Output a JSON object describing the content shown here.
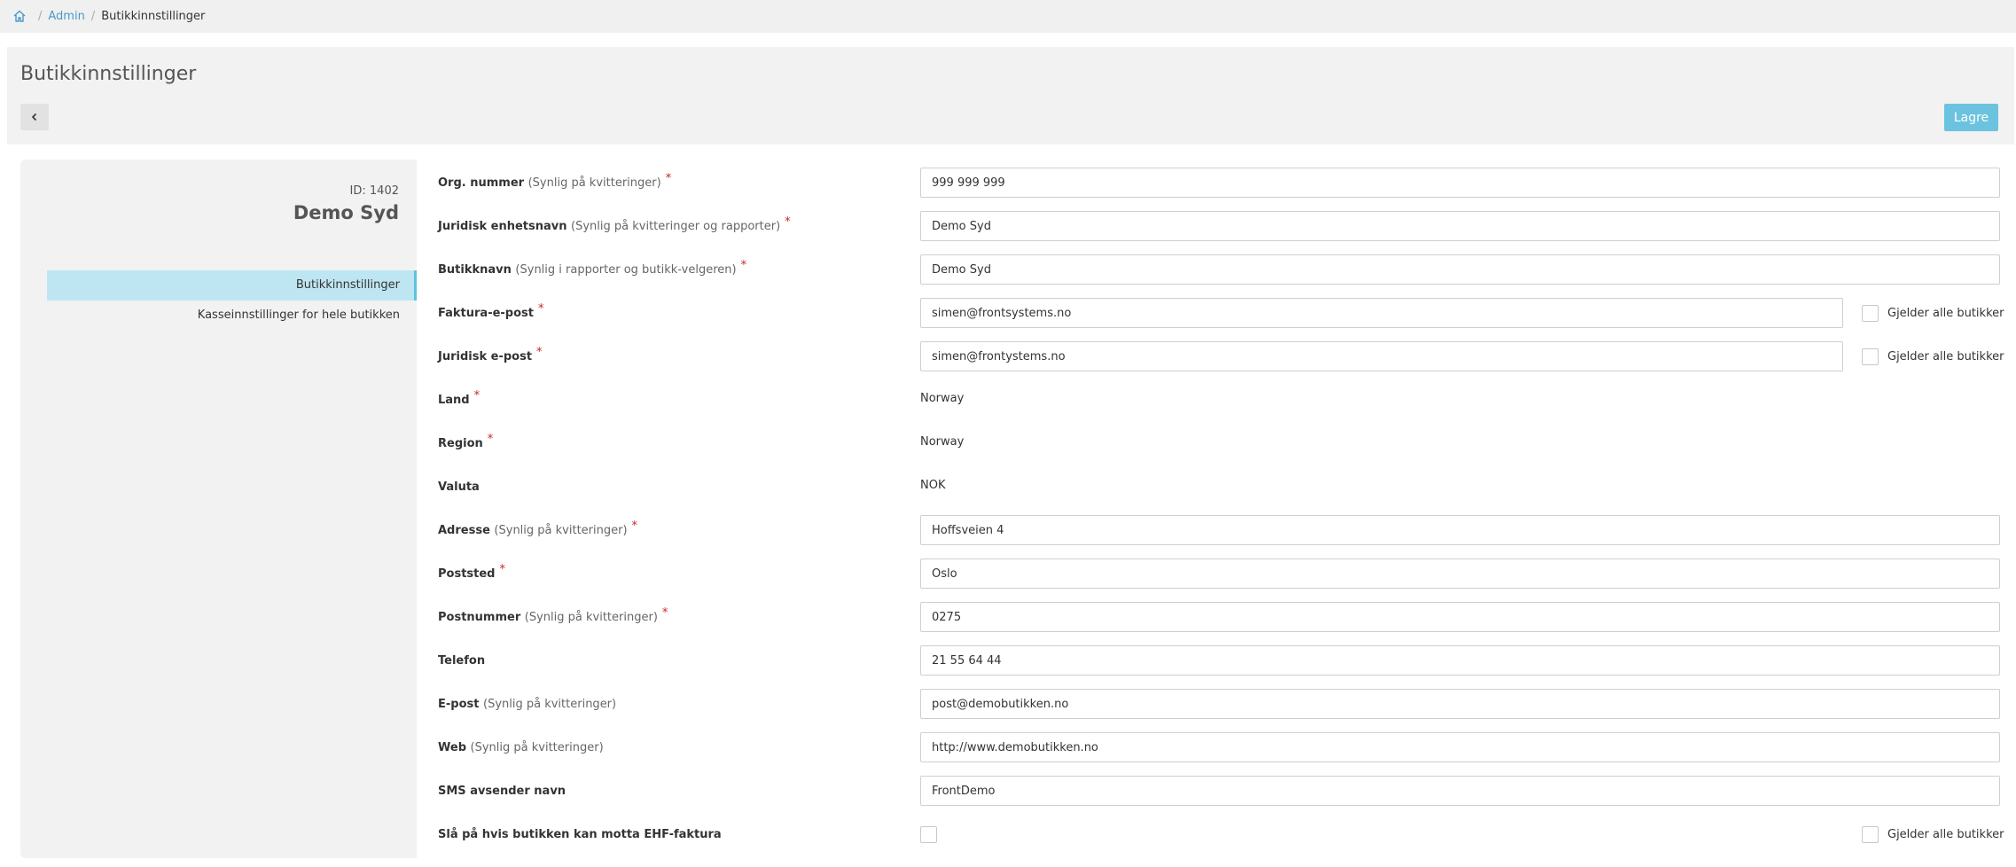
{
  "breadcrumb": {
    "admin": "Admin",
    "current": "Butikkinnstillinger"
  },
  "header": {
    "title": "Butikkinnstillinger",
    "save_label": "Lagre"
  },
  "sidebar": {
    "store_id": "ID: 1402",
    "store_name": "Demo Syd",
    "items": [
      {
        "label": "Butikkinnstillinger"
      },
      {
        "label": "Kasseinnstillinger for hele butikken"
      }
    ]
  },
  "form": {
    "org": {
      "label": "Org. nummer",
      "hint": "(Synlig på kvitteringer)",
      "req": "*",
      "value": "999 999 999"
    },
    "legal_name": {
      "label": "Juridisk enhetsnavn",
      "hint": "(Synlig på kvitteringer og rapporter)",
      "req": "*",
      "value": "Demo Syd"
    },
    "store_name": {
      "label": "Butikknavn",
      "hint": "(Synlig i rapporter og butikk-velgeren)",
      "req": "*",
      "value": "Demo Syd"
    },
    "invoice_email": {
      "label": "Faktura-e-post",
      "req": "*",
      "value": "simen@frontsystems.no",
      "check_label": "Gjelder alle butikker"
    },
    "legal_email": {
      "label": "Juridisk e-post",
      "req": "*",
      "value": "simen@frontystems.no",
      "check_label": "Gjelder alle butikker"
    },
    "country": {
      "label": "Land",
      "req": "*",
      "value": "Norway"
    },
    "region": {
      "label": "Region",
      "req": "*",
      "value": "Norway"
    },
    "currency": {
      "label": "Valuta",
      "value": "NOK"
    },
    "address": {
      "label": "Adresse",
      "hint": "(Synlig på kvitteringer)",
      "req": "*",
      "value": "Hoffsveien 4"
    },
    "city": {
      "label": "Poststed",
      "req": "*",
      "value": "Oslo"
    },
    "postcode": {
      "label": "Postnummer",
      "hint": "(Synlig på kvitteringer)",
      "req": "*",
      "value": "0275"
    },
    "phone": {
      "label": "Telefon",
      "value": "21 55 64 44"
    },
    "email": {
      "label": "E-post",
      "hint": "(Synlig på kvitteringer)",
      "value": "post@demobutikken.no"
    },
    "web": {
      "label": "Web",
      "hint": "(Synlig på kvitteringer)",
      "value": "http://www.demobutikken.no"
    },
    "sms": {
      "label": "SMS avsender navn",
      "value": "FrontDemo"
    },
    "ehf": {
      "label": "Slå på hvis butikken kan motta EHF-faktura",
      "check_label": "Gjelder alle butikker"
    }
  }
}
